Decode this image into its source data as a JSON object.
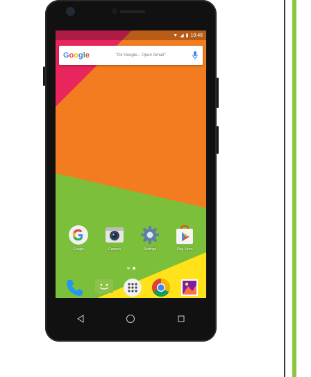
{
  "status_bar": {
    "time": "10:46"
  },
  "search": {
    "brand_letters": [
      "G",
      "o",
      "o",
      "g",
      "l",
      "e"
    ],
    "hint": "\"Ok Google... Open Gmail\""
  },
  "home_apps": [
    {
      "label": "Google",
      "icon": "google-icon"
    },
    {
      "label": "Camera",
      "icon": "camera-icon"
    },
    {
      "label": "Settings",
      "icon": "settings-icon"
    },
    {
      "label": "Play Store",
      "icon": "play-store-icon"
    }
  ],
  "dock_apps": [
    {
      "icon": "phone-icon"
    },
    {
      "icon": "messaging-icon"
    },
    {
      "icon": "app-drawer-icon"
    },
    {
      "icon": "chrome-icon"
    },
    {
      "icon": "gallery-icon"
    }
  ],
  "nav": [
    "back-icon",
    "home-icon",
    "recents-icon"
  ],
  "colors": {
    "orange": "#f47c20",
    "green": "#7cbf3a",
    "yellow": "#ffe21a",
    "pink": "#e8255d",
    "accent_green": "#8cc63f"
  }
}
